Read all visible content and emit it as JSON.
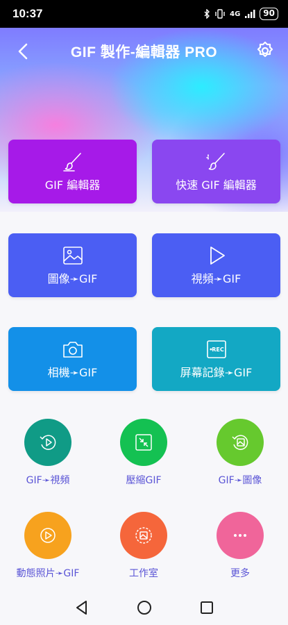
{
  "status": {
    "time": "10:37",
    "network": "4G",
    "battery": "90"
  },
  "header": {
    "title": "GIF 製作-編輯器 PRO"
  },
  "cards": [
    {
      "label": "GIF 編輯器",
      "icon": "brush-icon",
      "color": "#a61ae8"
    },
    {
      "label": "快速 GIF 編輯器",
      "icon": "quick-brush-icon",
      "color": "#8a47f0"
    },
    {
      "label": "圖像➛GIF",
      "icon": "image-icon",
      "color": "#4b5ef3"
    },
    {
      "label": "視頻➛GIF",
      "icon": "play-icon",
      "color": "#4b5ef3"
    },
    {
      "label": "相機➛GIF",
      "icon": "camera-icon",
      "color": "#1390e8"
    },
    {
      "label": "屏幕記錄➛GIF",
      "icon": "rec-icon",
      "color": "#13a8c4"
    }
  ],
  "tools": [
    {
      "label": "GIF➛視頻",
      "icon": "gif-to-video-icon",
      "color": "#109b86"
    },
    {
      "label": "壓縮GIF",
      "icon": "compress-icon",
      "color": "#14c152"
    },
    {
      "label": "GIF➛圖像",
      "icon": "gif-to-image-icon",
      "color": "#66c92e"
    },
    {
      "label": "動態照片➛GIF",
      "icon": "live-photo-icon",
      "color": "#f7a21e"
    },
    {
      "label": "工作室",
      "icon": "studio-icon",
      "color": "#f5663b"
    },
    {
      "label": "更多",
      "icon": "more-icon",
      "color": "#f0659a"
    }
  ]
}
